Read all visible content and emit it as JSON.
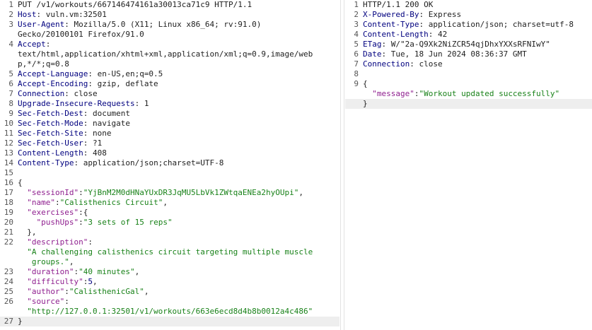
{
  "request": {
    "lines": [
      {
        "n": "1",
        "parts": [
          {
            "t": "PUT /v1/workouts/667146474161a30013ca71c9 HTTP/1.1",
            "c": ""
          }
        ]
      },
      {
        "n": "2",
        "parts": [
          {
            "t": "Host",
            "c": "k"
          },
          {
            "t": ": vuln.vm:32501",
            "c": ""
          }
        ]
      },
      {
        "n": "3",
        "parts": [
          {
            "t": "User-Agent",
            "c": "k"
          },
          {
            "t": ": Mozilla/5.0 (X11; Linux x86_64; rv:91.0)\nGecko/20100101 Firefox/91.0",
            "c": ""
          }
        ],
        "h": "two"
      },
      {
        "n": "4",
        "parts": [
          {
            "t": "Accept",
            "c": "k"
          },
          {
            "t": ":\ntext/html,application/xhtml+xml,application/xml;q=0.9,image/web\np,*/*;q=0.8",
            "c": ""
          }
        ],
        "h": "tall"
      },
      {
        "n": "5",
        "parts": [
          {
            "t": "Accept-Language",
            "c": "k"
          },
          {
            "t": ": en-US,en;q=0.5",
            "c": ""
          }
        ]
      },
      {
        "n": "6",
        "parts": [
          {
            "t": "Accept-Encoding",
            "c": "k"
          },
          {
            "t": ": gzip, deflate",
            "c": ""
          }
        ]
      },
      {
        "n": "7",
        "parts": [
          {
            "t": "Connection",
            "c": "k"
          },
          {
            "t": ": close",
            "c": ""
          }
        ]
      },
      {
        "n": "8",
        "parts": [
          {
            "t": "Upgrade-Insecure-Requests",
            "c": "k"
          },
          {
            "t": ": 1",
            "c": ""
          }
        ]
      },
      {
        "n": "9",
        "parts": [
          {
            "t": "Sec-Fetch-Dest",
            "c": "k"
          },
          {
            "t": ": document",
            "c": ""
          }
        ]
      },
      {
        "n": "10",
        "parts": [
          {
            "t": "Sec-Fetch-Mode",
            "c": "k"
          },
          {
            "t": ": navigate",
            "c": ""
          }
        ]
      },
      {
        "n": "11",
        "parts": [
          {
            "t": "Sec-Fetch-Site",
            "c": "k"
          },
          {
            "t": ": none",
            "c": ""
          }
        ]
      },
      {
        "n": "12",
        "parts": [
          {
            "t": "Sec-Fetch-User",
            "c": "k"
          },
          {
            "t": ": ?1",
            "c": ""
          }
        ]
      },
      {
        "n": "13",
        "parts": [
          {
            "t": "Content-Length",
            "c": "k"
          },
          {
            "t": ": 408",
            "c": ""
          }
        ]
      },
      {
        "n": "14",
        "parts": [
          {
            "t": "Content-Type",
            "c": "k"
          },
          {
            "t": ": application/json;charset=UTF-8",
            "c": ""
          }
        ]
      },
      {
        "n": "15",
        "parts": [
          {
            "t": "",
            "c": ""
          }
        ]
      },
      {
        "n": "16",
        "parts": [
          {
            "t": "{",
            "c": ""
          }
        ]
      },
      {
        "n": "17",
        "parts": [
          {
            "t": "  \"sessionId\"",
            "c": "n"
          },
          {
            "t": ":",
            "c": ""
          },
          {
            "t": "\"YjBnM2M0dHNaYUxDR3JqMU5LbVk1ZWtqaENEa2hyOUpi\"",
            "c": "s"
          },
          {
            "t": ",",
            "c": ""
          }
        ]
      },
      {
        "n": "18",
        "parts": [
          {
            "t": "  \"name\"",
            "c": "n"
          },
          {
            "t": ":",
            "c": ""
          },
          {
            "t": "\"Calisthenics Circuit\"",
            "c": "s"
          },
          {
            "t": ",",
            "c": ""
          }
        ]
      },
      {
        "n": "19",
        "parts": [
          {
            "t": "  \"exercises\"",
            "c": "n"
          },
          {
            "t": ":{",
            "c": ""
          }
        ]
      },
      {
        "n": "20",
        "parts": [
          {
            "t": "    \"pushUps\"",
            "c": "n"
          },
          {
            "t": ":",
            "c": ""
          },
          {
            "t": "\"3 sets of 15 reps\"",
            "c": "s"
          }
        ]
      },
      {
        "n": "21",
        "parts": [
          {
            "t": "  },",
            "c": ""
          }
        ]
      },
      {
        "n": "22",
        "parts": [
          {
            "t": "  \"description\"",
            "c": "n"
          },
          {
            "t": ":\n",
            "c": ""
          },
          {
            "t": "  \"A challenging calisthenics circuit targeting multiple muscle\n   groups.\"",
            "c": "s"
          },
          {
            "t": ",",
            "c": ""
          }
        ],
        "h": "tall"
      },
      {
        "n": "23",
        "parts": [
          {
            "t": "  \"duration\"",
            "c": "n"
          },
          {
            "t": ":",
            "c": ""
          },
          {
            "t": "\"40 minutes\"",
            "c": "s"
          },
          {
            "t": ",",
            "c": ""
          }
        ]
      },
      {
        "n": "24",
        "parts": [
          {
            "t": "  \"difficulty\"",
            "c": "n"
          },
          {
            "t": ":",
            "c": ""
          },
          {
            "t": "5",
            "c": "k"
          },
          {
            "t": ",",
            "c": ""
          }
        ]
      },
      {
        "n": "25",
        "parts": [
          {
            "t": "  \"author\"",
            "c": "n"
          },
          {
            "t": ":",
            "c": ""
          },
          {
            "t": "\"CalisthenicGal\"",
            "c": "s"
          },
          {
            "t": ",",
            "c": ""
          }
        ]
      },
      {
        "n": "26",
        "parts": [
          {
            "t": "  \"source\"",
            "c": "n"
          },
          {
            "t": ":\n",
            "c": ""
          },
          {
            "t": "  \"http://127.0.0.1:32501/v1/workouts/663e6ecd8d4b8b0012a4c486\"",
            "c": "s"
          }
        ],
        "h": "two"
      },
      {
        "n": "27",
        "parts": [
          {
            "t": "}",
            "c": ""
          }
        ],
        "hl": true
      }
    ]
  },
  "response": {
    "lines": [
      {
        "n": "1",
        "parts": [
          {
            "t": "HTTP/1.1 200 OK",
            "c": ""
          }
        ]
      },
      {
        "n": "2",
        "parts": [
          {
            "t": "X-Powered-By",
            "c": "k"
          },
          {
            "t": ": Express",
            "c": ""
          }
        ]
      },
      {
        "n": "3",
        "parts": [
          {
            "t": "Content-Type",
            "c": "k"
          },
          {
            "t": ": application/json; charset=utf-8",
            "c": ""
          }
        ]
      },
      {
        "n": "4",
        "parts": [
          {
            "t": "Content-Length",
            "c": "k"
          },
          {
            "t": ": 42",
            "c": ""
          }
        ]
      },
      {
        "n": "5",
        "parts": [
          {
            "t": "ETag",
            "c": "k"
          },
          {
            "t": ": W/\"2a-Q9Xk2NiZCR54qjDhxYXXsRFNIwY\"",
            "c": ""
          }
        ]
      },
      {
        "n": "6",
        "parts": [
          {
            "t": "Date",
            "c": "k"
          },
          {
            "t": ": Tue, 18 Jun 2024 08:36:37 GMT",
            "c": ""
          }
        ]
      },
      {
        "n": "7",
        "parts": [
          {
            "t": "Connection",
            "c": "k"
          },
          {
            "t": ": close",
            "c": ""
          }
        ]
      },
      {
        "n": "8",
        "parts": [
          {
            "t": "",
            "c": ""
          }
        ]
      },
      {
        "n": "9",
        "parts": [
          {
            "t": "{",
            "c": ""
          }
        ]
      },
      {
        "n": "",
        "parts": [
          {
            "t": "  \"message\"",
            "c": "n"
          },
          {
            "t": ":",
            "c": ""
          },
          {
            "t": "\"Workout updated successfully\"",
            "c": "s"
          }
        ]
      },
      {
        "n": "",
        "parts": [
          {
            "t": "}",
            "c": ""
          }
        ],
        "hl": true
      }
    ]
  }
}
